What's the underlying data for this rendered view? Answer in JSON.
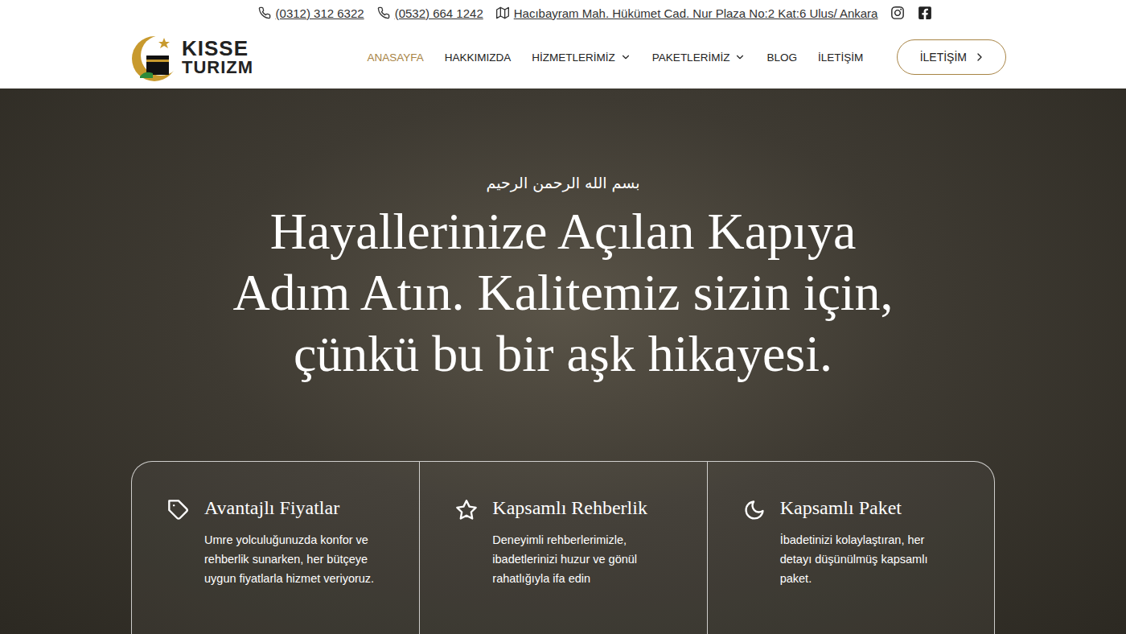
{
  "topbar": {
    "phones": [
      "(0312) 312 6322",
      "(0532) 664 1242"
    ],
    "address": "Hacıbayram Mah. Hükümet Cad. Nur Plaza No:2 Kat:6 Ulus/ Ankara"
  },
  "logo": {
    "line1": "KISSE",
    "line2": "TURIZM"
  },
  "nav": [
    {
      "label": "ANASAYFA",
      "selected": true,
      "dropdown": false
    },
    {
      "label": "HAKKIMIZDA",
      "selected": false,
      "dropdown": false
    },
    {
      "label": "HİZMETLERİMİZ",
      "selected": false,
      "dropdown": true
    },
    {
      "label": "PAKETLERİMİZ",
      "selected": false,
      "dropdown": true
    },
    {
      "label": "BLOG",
      "selected": false,
      "dropdown": false
    },
    {
      "label": "İLETİŞİM",
      "selected": false,
      "dropdown": false
    }
  ],
  "cta": "İLETİŞİM",
  "hero": {
    "bismillah": "بسم الله الرحمن الرحيم",
    "headline": "Hayallerinize Açılan Kapıya Adım Atın. Kalitemiz sizin için, çünkü bu bir aşk hikayesi."
  },
  "features": [
    {
      "title": "Avantajlı Fiyatlar",
      "text": "Umre yolculuğunuzda konfor ve rehberlik sunarken, her bütçeye uygun fiyatlarla hizmet veriyoruz."
    },
    {
      "title": "Kapsamlı Rehberlik",
      "text": "Deneyimli rehberlerimizle, ibadetlerinizi huzur ve gönül rahatlığıyla ifa edin"
    },
    {
      "title": "Kapsamlı Paket",
      "text": "İbadetinizi kolaylaştıran, her detayı düşünülmüş kapsamlı paket."
    }
  ]
}
